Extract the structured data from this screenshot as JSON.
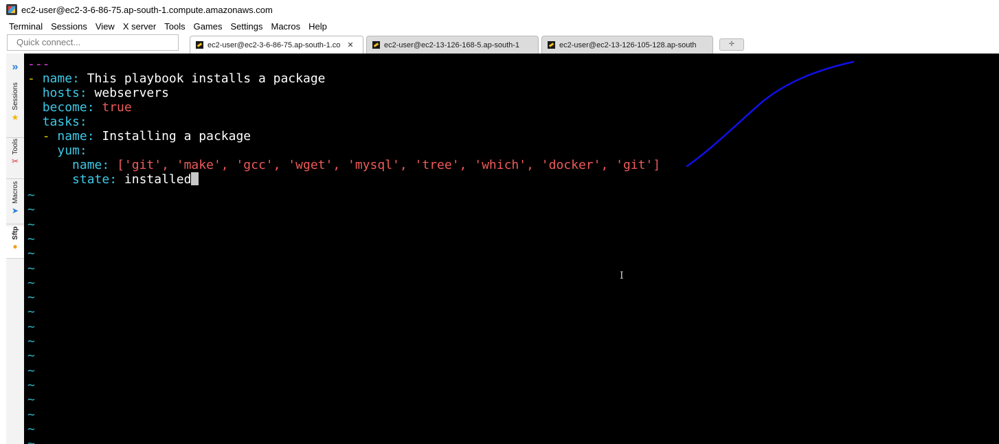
{
  "window": {
    "title": "ec2-user@ec2-3-6-86-75.ap-south-1.compute.amazonaws.com"
  },
  "menu": [
    "Terminal",
    "Sessions",
    "View",
    "X server",
    "Tools",
    "Games",
    "Settings",
    "Macros",
    "Help"
  ],
  "quick_connect": {
    "placeholder": "Quick connect..."
  },
  "tabs": [
    {
      "label": "ec2-user@ec2-3-6-86-75.ap-south-1.co",
      "active": true,
      "close": "✕"
    },
    {
      "label": "ec2-user@ec2-13-126-168-5.ap-south-1",
      "active": false
    },
    {
      "label": "ec2-user@ec2-13-126-105-128.ap-south",
      "active": false
    }
  ],
  "new_tab_icon": "plus-icon",
  "side_panel": {
    "toggle": "»",
    "tabs": [
      {
        "label": "Sessions",
        "icon": "star-icon"
      },
      {
        "label": "Tools",
        "icon": "tools-icon"
      },
      {
        "label": "Macros",
        "icon": "paper-plane-icon"
      },
      {
        "label": "Sftp",
        "icon": "sftp-icon"
      }
    ]
  },
  "editor": {
    "doc_start": "---",
    "lines": [
      {
        "dash": "- ",
        "key": "name:",
        "value": " This playbook installs a package"
      },
      {
        "key": "hosts:",
        "value": " webservers"
      },
      {
        "key": "become:",
        "value_bool": " true"
      },
      {
        "key": "tasks:"
      },
      {
        "dash": "- ",
        "key": "name:",
        "value": " Installing a package"
      },
      {
        "key": "yum:"
      },
      {
        "key": "name:",
        "list": "['git', 'make', 'gcc', 'wget', 'mysql', 'tree', 'which', 'docker', 'git']"
      },
      {
        "key": "state:",
        "value": " installed"
      }
    ],
    "tilde": "~"
  },
  "colors": {
    "terminal_bg": "#000000",
    "key": "#3ec9e8",
    "string": "#f05a5a",
    "doc_marker": "#e040e0",
    "annotation_stroke": "#1010e8"
  }
}
